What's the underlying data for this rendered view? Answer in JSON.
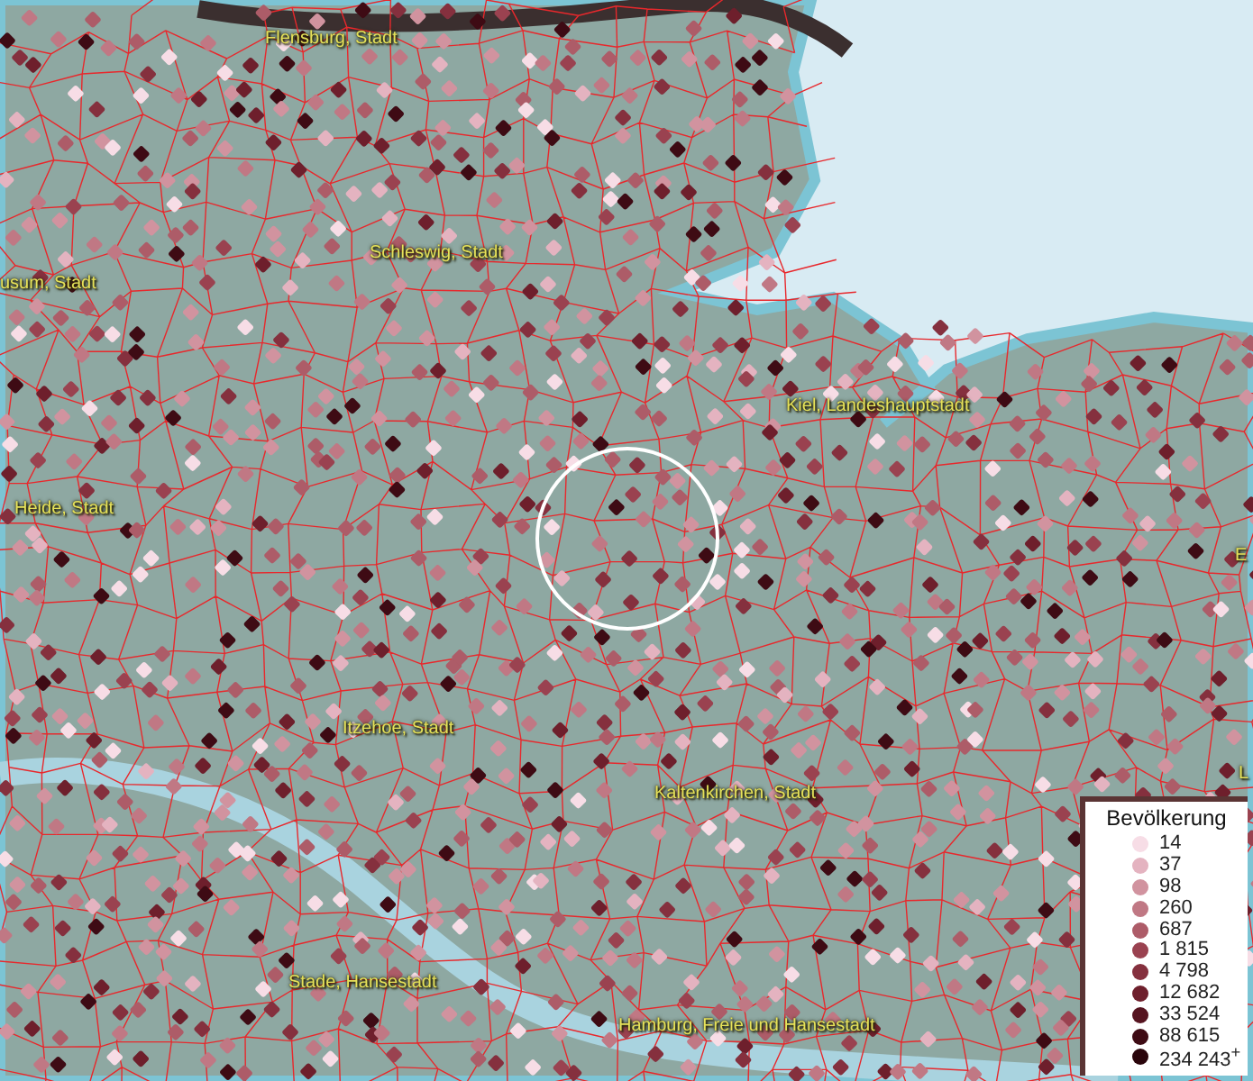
{
  "map": {
    "labels": [
      {
        "text": "Flensburg, Stadt"
      },
      {
        "text": "Schleswig, Stadt"
      },
      {
        "text": "usum, Stadt"
      },
      {
        "text": "Kiel, Landeshauptstadt"
      },
      {
        "text": "Heide, Stadt"
      },
      {
        "text": "E"
      },
      {
        "text": "Itzehoe, Stadt"
      },
      {
        "text": "L"
      },
      {
        "text": "Kaltenkirchen, Stadt"
      },
      {
        "text": "Stade, Hansestadt"
      },
      {
        "text": "Hamburg, Freie und Hansestadt"
      }
    ]
  },
  "legend": {
    "title": "Bevölkerung",
    "items": [
      {
        "label": "14",
        "color": "#f7dde6"
      },
      {
        "label": "37",
        "color": "#e4b3c0"
      },
      {
        "label": "98",
        "color": "#d1939f"
      },
      {
        "label": "260",
        "color": "#c07884"
      },
      {
        "label": "687",
        "color": "#ad5c68"
      },
      {
        "label": "1 815",
        "color": "#9a4250"
      },
      {
        "label": "4 798",
        "color": "#85303e"
      },
      {
        "label": "12 682",
        "color": "#6e1f2c"
      },
      {
        "label": "33 524",
        "color": "#561420"
      },
      {
        "label": "88 615",
        "color": "#3e0b14"
      },
      {
        "label": "234 243$^{+}$",
        "color": "#2a050b"
      }
    ]
  }
}
